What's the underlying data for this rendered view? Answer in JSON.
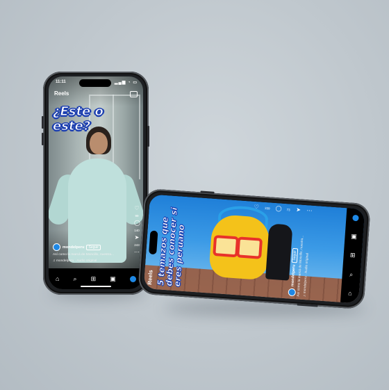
{
  "phone1": {
    "status_time": "11:11",
    "header_title": "Reels",
    "caption": "¿Este o este?",
    "side_counts": [
      "",
      "99",
      "140",
      "243"
    ],
    "username": "mondelperu",
    "follow_label": "Seguir",
    "description": "Así como la marcá de Moncillo, nuestra...",
    "audio": "mondelperu · Audio original",
    "nav_icons": [
      "home-icon",
      "search-icon",
      "add-icon",
      "reels-icon",
      "profile-icon"
    ]
  },
  "phone2": {
    "header_title": "Reels",
    "caption_lines": [
      "5 temazos que",
      "debes conocer si",
      "eres peruano"
    ],
    "side_counts": [
      "339",
      "73"
    ],
    "username": "mondelperu",
    "follow_label": "Seguir",
    "description": "Así como la marcá de Moncillo, nuestra...",
    "audio": "mondelperu · Audio original"
  },
  "colors": {
    "caption_stroke": "#1c3fb0",
    "background": "#bfc7cd",
    "phone_body": "#1d1f22",
    "mascot": "#f4c21a",
    "glasses": "#e8322a"
  }
}
